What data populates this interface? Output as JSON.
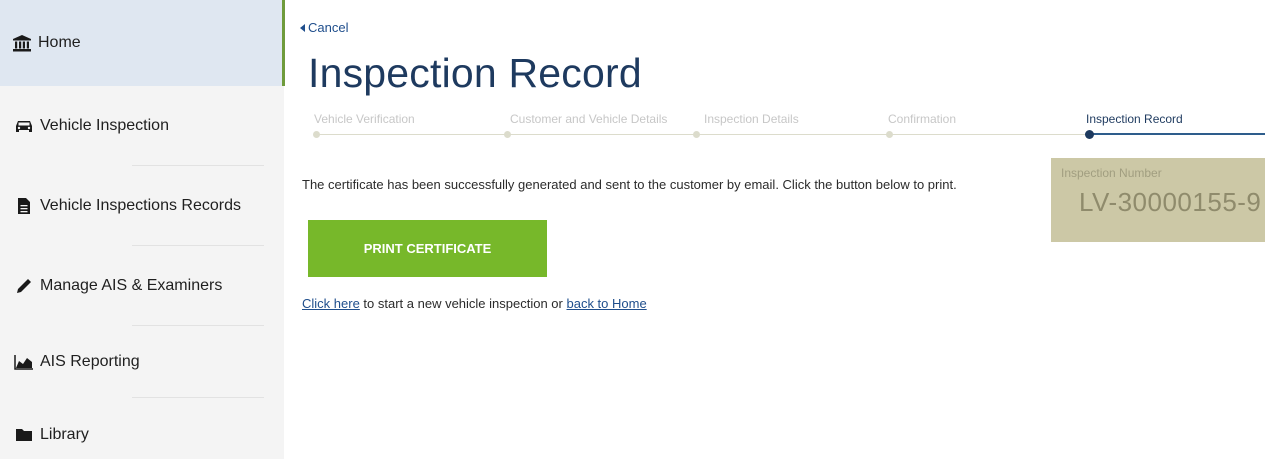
{
  "sidebar": {
    "items": [
      {
        "label": "Home",
        "icon": "bank-icon"
      },
      {
        "label": "Vehicle Inspection",
        "icon": "car-icon"
      },
      {
        "label": "Vehicle Inspections Records",
        "icon": "document-icon"
      },
      {
        "label": "Manage AIS & Examiners",
        "icon": "pencil-icon"
      },
      {
        "label": "AIS Reporting",
        "icon": "area-chart-icon"
      },
      {
        "label": "Library",
        "icon": "folder-icon"
      }
    ]
  },
  "main": {
    "cancel_label": "Cancel",
    "title": "Inspection Record",
    "steps": [
      "Vehicle Verification",
      "Customer and Vehicle Details",
      "Inspection Details",
      "Confirmation",
      "Inspection Record"
    ],
    "message": "The certificate has been successfully generated and sent to the customer by email. Click the button below to print.",
    "inspection_label": "Inspection Number",
    "inspection_number": "LV-30000155-9",
    "print_button": "PRINT CERTIFICATE",
    "click_here_link": "Click here",
    "middle_text": "to start a new vehicle inspection or",
    "back_home_link": "back to Home"
  },
  "colors": {
    "accent_green": "#77b82a",
    "title_blue": "#1e3a5f",
    "link_blue": "#1f4e8c",
    "inspection_box": "#ccc8a6"
  }
}
